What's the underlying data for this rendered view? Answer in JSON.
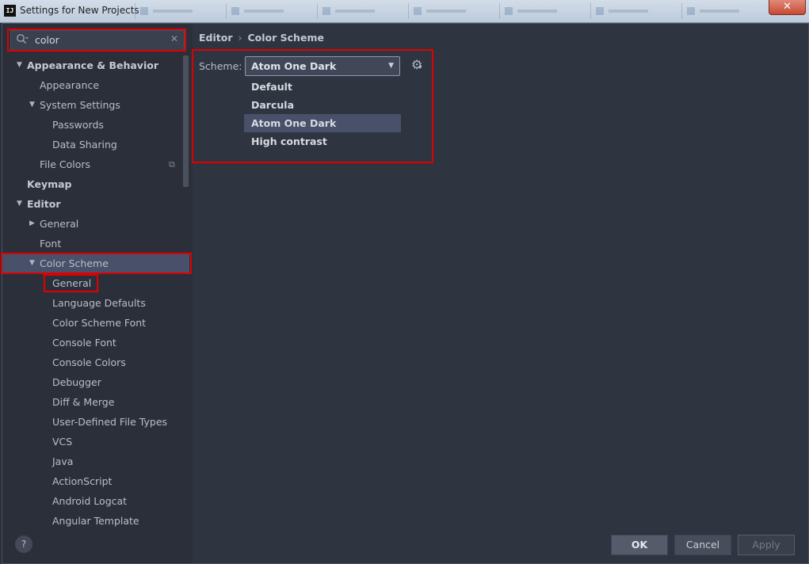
{
  "window": {
    "title": "Settings for New Projects",
    "app_icon_text": "IJ",
    "close_glyph": "✕"
  },
  "search": {
    "value": "color",
    "icon": "search-icon",
    "clear_glyph": "✕"
  },
  "tree": [
    {
      "label": "Appearance & Behavior",
      "arrow": "▼"
    },
    {
      "label": "Appearance",
      "arrow": ""
    },
    {
      "label": "System Settings",
      "arrow": "▼"
    },
    {
      "label": "Passwords",
      "arrow": ""
    },
    {
      "label": "Data Sharing",
      "arrow": ""
    },
    {
      "label": "File Colors",
      "arrow": ""
    },
    {
      "label": "Keymap",
      "arrow": ""
    },
    {
      "label": "Editor",
      "arrow": "▼"
    },
    {
      "label": "General",
      "arrow": "▶"
    },
    {
      "label": "Font",
      "arrow": ""
    },
    {
      "label": "Color Scheme",
      "arrow": "▼"
    },
    {
      "label": "General",
      "arrow": ""
    },
    {
      "label": "Language Defaults",
      "arrow": ""
    },
    {
      "label": "Color Scheme Font",
      "arrow": ""
    },
    {
      "label": "Console Font",
      "arrow": ""
    },
    {
      "label": "Console Colors",
      "arrow": ""
    },
    {
      "label": "Debugger",
      "arrow": ""
    },
    {
      "label": "Diff & Merge",
      "arrow": ""
    },
    {
      "label": "User-Defined File Types",
      "arrow": ""
    },
    {
      "label": "VCS",
      "arrow": ""
    },
    {
      "label": "Java",
      "arrow": ""
    },
    {
      "label": "ActionScript",
      "arrow": ""
    },
    {
      "label": "Android Logcat",
      "arrow": ""
    },
    {
      "label": "Angular Template",
      "arrow": ""
    }
  ],
  "file_colors_icon": "⧉",
  "breadcrumb": {
    "parent": "Editor",
    "separator": "›",
    "current": "Color Scheme"
  },
  "scheme": {
    "label": "Scheme:",
    "selected": "Atom One Dark",
    "arrow": "▼",
    "gear_glyph": "⚙",
    "gear_sub": "▾",
    "options": [
      "Default",
      "Darcula",
      "Atom One Dark",
      "High contrast"
    ]
  },
  "buttons": {
    "help": "?",
    "ok": "OK",
    "cancel": "Cancel",
    "apply": "Apply"
  },
  "colors": {
    "panel_bg": "#2f3441",
    "selection_bg": "#48506a",
    "highlight_border": "#e00000"
  }
}
